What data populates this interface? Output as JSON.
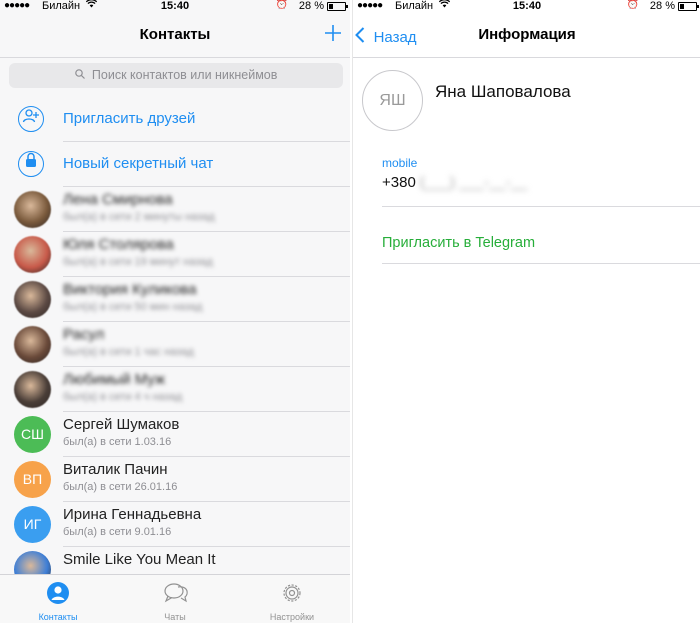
{
  "status_bar": {
    "signal": "●●●●●",
    "carrier": "Билайн",
    "wifi": "wifi-icon",
    "time": "15:40",
    "alarm": "alarm-icon",
    "battery_percent_label": "28 %",
    "battery_level": 0.28
  },
  "contacts_screen": {
    "title": "Контакты",
    "add_icon": "plus-icon",
    "search_placeholder": "Поиск контактов или никнеймов",
    "actions": [
      {
        "label": "Пригласить друзей",
        "icon": "add-person-icon"
      },
      {
        "label": "Новый секретный чат",
        "icon": "lock-icon"
      }
    ],
    "contacts": [
      {
        "name": "Лена Смирнова",
        "status": "был(а) в сети 2 минуты назад",
        "blurred": true,
        "avatar_color": "#7a5a3c"
      },
      {
        "name": "Юля Столярова",
        "status": "был(а) в сети 19 минут назад",
        "blurred": true,
        "avatar_color": "#c85a4a"
      },
      {
        "name": "Виктория Куликова",
        "status": "был(а) в сети 50 мин назад",
        "blurred": true,
        "avatar_color": "#5c4a44"
      },
      {
        "name": "Расул",
        "status": "был(а) в сети 1 час назад",
        "blurred": true,
        "avatar_color": "#6a4a3a"
      },
      {
        "name": "Любимый Муж",
        "status": "был(а) в сети 4 ч назад",
        "blurred": true,
        "avatar_color": "#4a3e38"
      },
      {
        "name": "Сергей Шумаков",
        "status": "был(а) в сети 1.03.16",
        "blurred": false,
        "initials": "СШ",
        "avatar_color": "#4cbc56"
      },
      {
        "name": "Виталик Пачин",
        "status": "был(а) в сети 26.01.16",
        "blurred": false,
        "initials": "ВП",
        "avatar_color": "#f7a24a"
      },
      {
        "name": "Ирина Геннадьевна",
        "status": "был(а) в сети 9.01.16",
        "blurred": false,
        "initials": "ИГ",
        "avatar_color": "#3a9ef0"
      },
      {
        "name": "Smile Like You Mean It",
        "status": "",
        "blurred": false,
        "avatar_color": "#3f7fd6"
      }
    ],
    "tabs": [
      {
        "label": "Контакты",
        "icon": "person-icon",
        "active": true
      },
      {
        "label": "Чаты",
        "icon": "chat-bubbles-icon",
        "active": false
      },
      {
        "label": "Настройки",
        "icon": "gear-icon",
        "active": false
      }
    ]
  },
  "info_screen": {
    "back_label": "Назад",
    "back_icon": "chevron-left-icon",
    "title": "Информация",
    "avatar_initials": "ЯШ",
    "name": "Яна Шаповалова",
    "phone_label": "mobile",
    "phone_prefix": "+380",
    "phone_hidden": "(___) ___-__-__",
    "invite_label": "Пригласить в Telegram"
  },
  "colors": {
    "accent": "#1f8ef1",
    "invite_green": "#27ae3a"
  }
}
